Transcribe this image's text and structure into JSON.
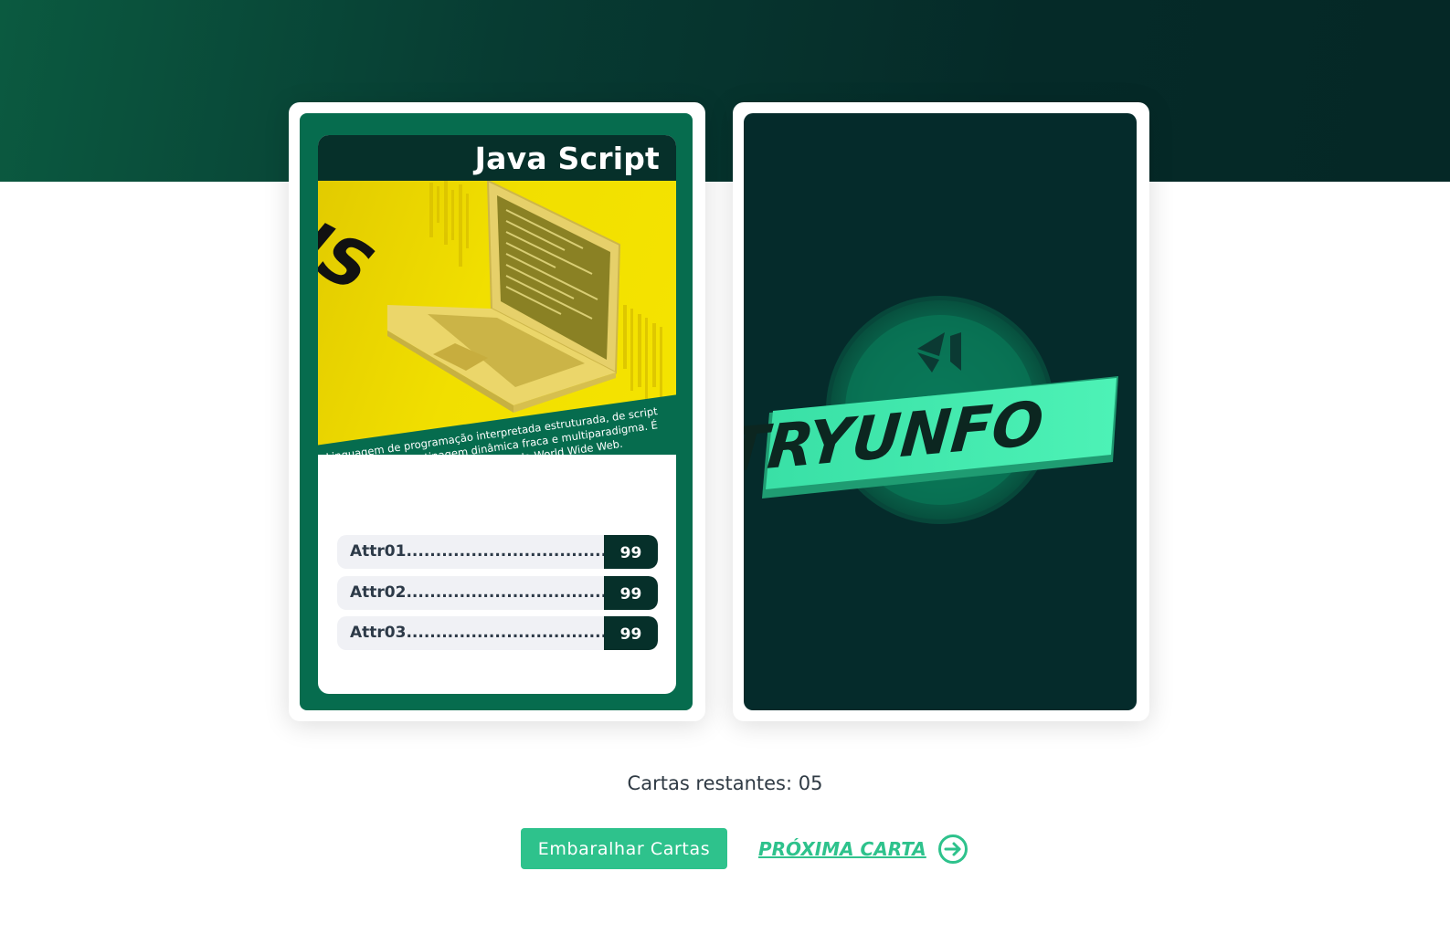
{
  "card": {
    "name": "Java Script",
    "description": "Linguagem de programação interpretada estruturada, de script em alto nível com tipagem dinâmica fraca e multiparadigma. É uma das três principais tecnologias da World Wide Web.",
    "image_caption": "JS",
    "attributes": [
      {
        "label": "Attr01...................................",
        "value": "99"
      },
      {
        "label": "Attr02...................................",
        "value": "99"
      },
      {
        "label": "Attr03...................................",
        "value": "99"
      }
    ]
  },
  "card_back": {
    "logo_text": "TRYUNFO"
  },
  "status": {
    "remaining": "Cartas restantes: 05"
  },
  "actions": {
    "shuffle_label": "Embaralhar Cartas",
    "next_label": "PRÓXIMA CARTA"
  },
  "colors": {
    "primary_green": "#066c4e",
    "dark_teal": "#052b2b",
    "accent": "#2ec28c",
    "js_yellow": "#f0dc00"
  },
  "icons": {
    "next": "arrow-right-circle-icon",
    "logo": "tryunfo-logo"
  }
}
